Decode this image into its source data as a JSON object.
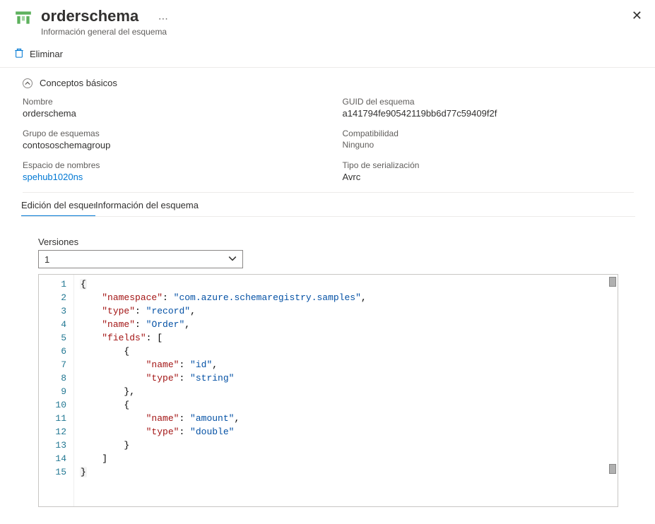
{
  "header": {
    "title": "orderschema",
    "subtitle": "Información general del esquema"
  },
  "toolbar": {
    "delete_label": "Eliminar"
  },
  "sections": {
    "basics_title": "Conceptos básicos"
  },
  "fields": {
    "name": {
      "label": "Nombre",
      "value": "orderschema"
    },
    "guid": {
      "label": "GUID del esquema",
      "value": "a141794fe90542119bb6d77c59409f2f"
    },
    "group": {
      "label": "Grupo de esquemas",
      "value": "contososchemagroup"
    },
    "compat": {
      "label": "Compatibilidad",
      "value": "Ninguno"
    },
    "namespace": {
      "label": "Espacio de nombres",
      "value": "spehub1020ns"
    },
    "serialization": {
      "label": "Tipo de serialización",
      "value": "Avrc"
    }
  },
  "tabs": {
    "edit": "Edición del esquema",
    "info": "Información del esquema"
  },
  "versions": {
    "label": "Versiones",
    "selected": "1"
  },
  "code": {
    "lines": [
      [
        {
          "t": "brace",
          "v": "{"
        }
      ],
      [
        {
          "t": "ind",
          "v": "    "
        },
        {
          "t": "key",
          "v": "\"namespace\""
        },
        {
          "t": "punc",
          "v": ": "
        },
        {
          "t": "str",
          "v": "\"com.azure.schemaregistry.samples\""
        },
        {
          "t": "punc",
          "v": ","
        }
      ],
      [
        {
          "t": "ind",
          "v": "    "
        },
        {
          "t": "key",
          "v": "\"type\""
        },
        {
          "t": "punc",
          "v": ": "
        },
        {
          "t": "str",
          "v": "\"record\""
        },
        {
          "t": "punc",
          "v": ","
        }
      ],
      [
        {
          "t": "ind",
          "v": "    "
        },
        {
          "t": "key",
          "v": "\"name\""
        },
        {
          "t": "punc",
          "v": ": "
        },
        {
          "t": "str",
          "v": "\"Order\""
        },
        {
          "t": "punc",
          "v": ","
        }
      ],
      [
        {
          "t": "ind",
          "v": "    "
        },
        {
          "t": "key",
          "v": "\"fields\""
        },
        {
          "t": "punc",
          "v": ": ["
        }
      ],
      [
        {
          "t": "ind",
          "v": "        "
        },
        {
          "t": "punc",
          "v": "{"
        }
      ],
      [
        {
          "t": "ind",
          "v": "            "
        },
        {
          "t": "key",
          "v": "\"name\""
        },
        {
          "t": "punc",
          "v": ": "
        },
        {
          "t": "str",
          "v": "\"id\""
        },
        {
          "t": "punc",
          "v": ","
        }
      ],
      [
        {
          "t": "ind",
          "v": "            "
        },
        {
          "t": "key",
          "v": "\"type\""
        },
        {
          "t": "punc",
          "v": ": "
        },
        {
          "t": "str",
          "v": "\"string\""
        }
      ],
      [
        {
          "t": "ind",
          "v": "        "
        },
        {
          "t": "punc",
          "v": "},"
        }
      ],
      [
        {
          "t": "ind",
          "v": "        "
        },
        {
          "t": "punc",
          "v": "{"
        }
      ],
      [
        {
          "t": "ind",
          "v": "            "
        },
        {
          "t": "key",
          "v": "\"name\""
        },
        {
          "t": "punc",
          "v": ": "
        },
        {
          "t": "str",
          "v": "\"amount\""
        },
        {
          "t": "punc",
          "v": ","
        }
      ],
      [
        {
          "t": "ind",
          "v": "            "
        },
        {
          "t": "key",
          "v": "\"type\""
        },
        {
          "t": "punc",
          "v": ": "
        },
        {
          "t": "str",
          "v": "\"double\""
        }
      ],
      [
        {
          "t": "ind",
          "v": "        "
        },
        {
          "t": "punc",
          "v": "}"
        }
      ],
      [
        {
          "t": "ind",
          "v": "    "
        },
        {
          "t": "punc",
          "v": "]"
        }
      ],
      [
        {
          "t": "brace",
          "v": "}"
        }
      ]
    ]
  }
}
